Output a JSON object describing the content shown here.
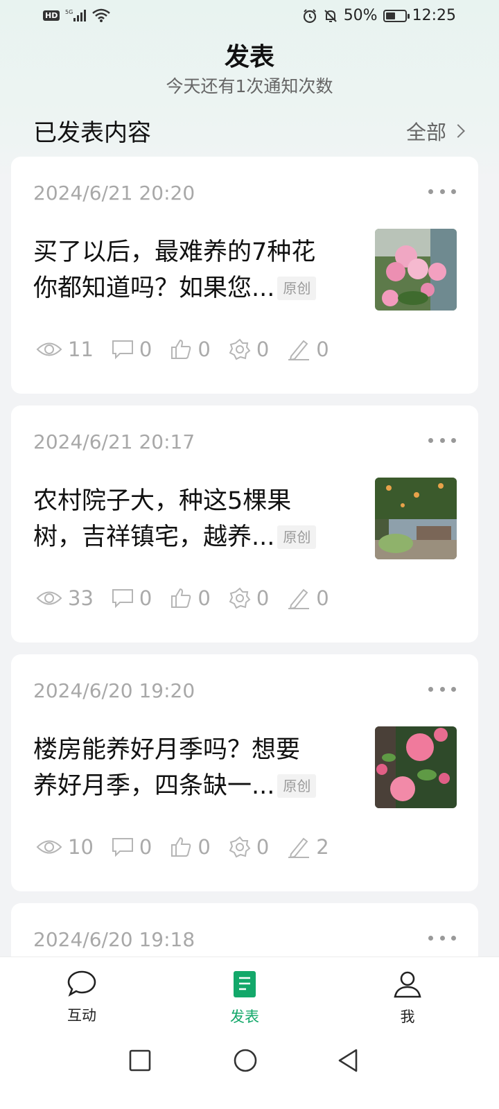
{
  "status_bar": {
    "left_icons": [
      "hd-icon",
      "signal-icon",
      "wifi-icon"
    ],
    "hd_label": "HD",
    "right_icons": [
      "alarm-icon",
      "mute-icon",
      "battery-icon"
    ],
    "battery_percent": "50%",
    "battery_level": 0.5,
    "time": "12:25"
  },
  "header": {
    "title": "发表",
    "subtitle": "今天还有1次通知次数"
  },
  "section": {
    "title": "已发表内容",
    "all_link": "全部"
  },
  "posts": [
    {
      "date": "2024/6/21 20:20",
      "title_line1": "买了以后，最难养的7种花",
      "title_line2": "你都知道吗？如果您...",
      "badge": "原创",
      "thumbnail": "pink-geranium-flowers",
      "views": "11",
      "comments": "0",
      "likes": "0",
      "shares": "0",
      "edits": "0"
    },
    {
      "date": "2024/6/21 20:17",
      "title_line1": "农村院子大，种这5棵果",
      "title_line2": "树，吉祥镇宅，越养...",
      "badge": "原创",
      "thumbnail": "fruit-tree-courtyard",
      "views": "33",
      "comments": "0",
      "likes": "0",
      "shares": "0",
      "edits": "0"
    },
    {
      "date": "2024/6/20 19:20",
      "title_line1": "楼房能养好月季吗？想要",
      "title_line2": "养好月季，四条缺一...",
      "badge": "原创",
      "thumbnail": "pink-roses",
      "views": "10",
      "comments": "0",
      "likes": "0",
      "shares": "0",
      "edits": "2"
    },
    {
      "date": "2024/6/20 19:18"
    }
  ],
  "bottom_nav": {
    "items": [
      {
        "label": "互动",
        "icon": "chat-bubble-icon"
      },
      {
        "label": "发表",
        "icon": "document-icon",
        "active": true
      },
      {
        "label": "我",
        "icon": "person-icon"
      }
    ],
    "active_color": "#13a86a"
  },
  "system_nav": [
    "recent-apps-icon",
    "home-icon",
    "back-icon"
  ]
}
